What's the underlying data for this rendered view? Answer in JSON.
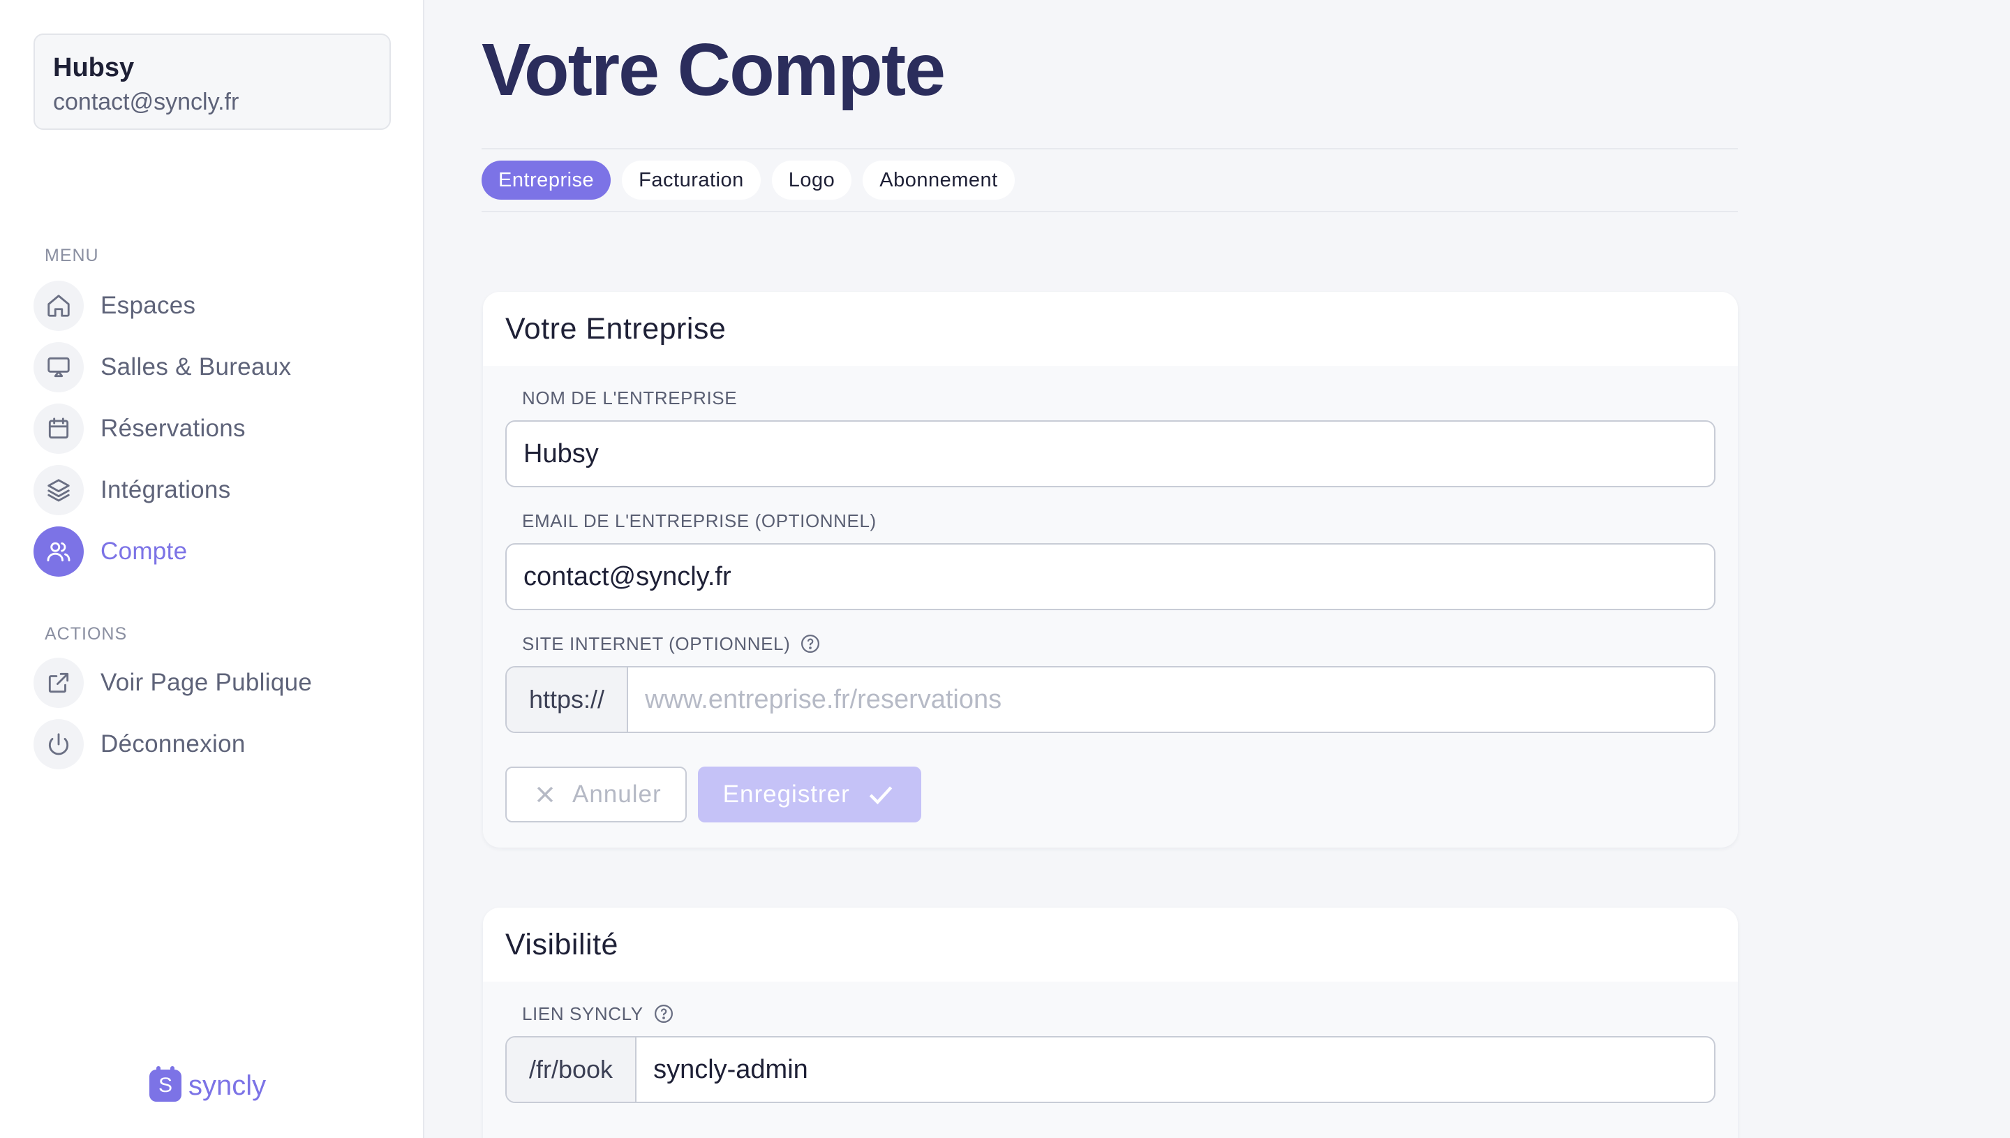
{
  "account": {
    "name": "Hubsy",
    "email": "contact@syncly.fr"
  },
  "sidebar": {
    "menu_label": "MENU",
    "menu_items": [
      {
        "label": "Espaces",
        "icon": "home-icon"
      },
      {
        "label": "Salles & Bureaux",
        "icon": "monitor-icon"
      },
      {
        "label": "Réservations",
        "icon": "calendar-icon"
      },
      {
        "label": "Intégrations",
        "icon": "layers-icon"
      },
      {
        "label": "Compte",
        "icon": "users-icon",
        "active": true
      }
    ],
    "actions_label": "ACTIONS",
    "action_items": [
      {
        "label": "Voir Page Publique",
        "icon": "external-link-icon"
      },
      {
        "label": "Déconnexion",
        "icon": "power-icon"
      }
    ],
    "brand": {
      "mark": "S",
      "name": "syncly"
    }
  },
  "main": {
    "title": "Votre Compte",
    "tabs": [
      {
        "label": "Entreprise",
        "active": true
      },
      {
        "label": "Facturation"
      },
      {
        "label": "Logo"
      },
      {
        "label": "Abonnement"
      }
    ]
  },
  "company_card": {
    "title": "Votre Entreprise",
    "name_label": "NOM DE L'ENTREPRISE",
    "name_value": "Hubsy",
    "email_label": "EMAIL DE L'ENTREPRISE (OPTIONNEL)",
    "email_value": "contact@syncly.fr",
    "website_label": "SITE INTERNET (OPTIONNEL)",
    "website_prefix": "https://",
    "website_value": "",
    "website_placeholder": "www.entreprise.fr/reservations",
    "cancel_label": "Annuler",
    "save_label": "Enregistrer"
  },
  "visibility_card": {
    "title": "Visibilité",
    "link_label": "LIEN SYNCLY",
    "link_prefix": "/fr/book",
    "link_value": "syncly-admin"
  },
  "colors": {
    "accent": "#7c73e6",
    "accent_disabled": "#c5c2f7",
    "title": "#2b2d5c",
    "background": "#f5f6f9"
  }
}
